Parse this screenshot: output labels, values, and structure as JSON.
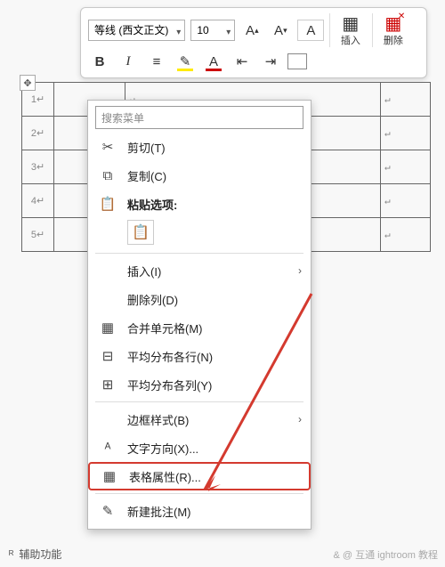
{
  "ribbon": {
    "font_name": "等线 (西文正文)",
    "font_size": "10",
    "insert_label": "插入",
    "delete_label": "删除"
  },
  "rows": [
    "1",
    "2",
    "3",
    "4",
    "5"
  ],
  "search_placeholder": "搜索菜单",
  "menu": {
    "cut": "剪切(T)",
    "copy": "复制(C)",
    "paste_options": "粘贴选项:",
    "insert": "插入(I)",
    "delete_col": "删除列(D)",
    "merge_cells": "合并单元格(M)",
    "dist_rows": "平均分布各行(N)",
    "dist_cols": "平均分布各列(Y)",
    "border_style": "边框样式(B)",
    "text_dir": "文字方向(X)...",
    "table_props": "表格属性(R)...",
    "new_comment": "新建批注(M)"
  },
  "footer": "辅助功能",
  "watermark": "& @ 互通 ightroom 教程"
}
